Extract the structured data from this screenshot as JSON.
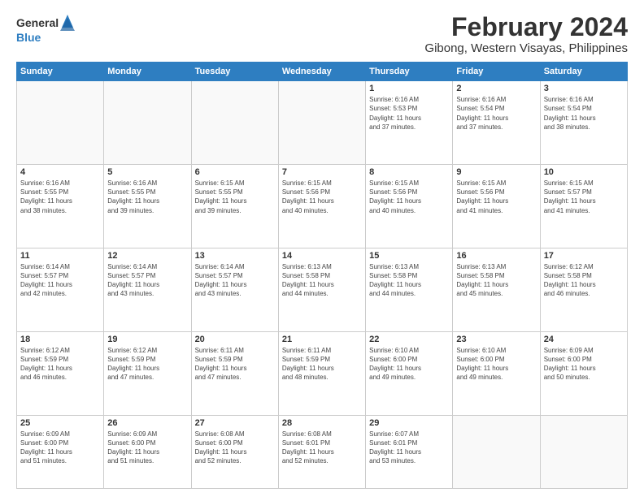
{
  "header": {
    "logo_general": "General",
    "logo_blue": "Blue",
    "month": "February 2024",
    "location": "Gibong, Western Visayas, Philippines"
  },
  "days_of_week": [
    "Sunday",
    "Monday",
    "Tuesday",
    "Wednesday",
    "Thursday",
    "Friday",
    "Saturday"
  ],
  "weeks": [
    [
      {
        "day": "",
        "info": ""
      },
      {
        "day": "",
        "info": ""
      },
      {
        "day": "",
        "info": ""
      },
      {
        "day": "",
        "info": ""
      },
      {
        "day": "1",
        "info": "Sunrise: 6:16 AM\nSunset: 5:53 PM\nDaylight: 11 hours\nand 37 minutes."
      },
      {
        "day": "2",
        "info": "Sunrise: 6:16 AM\nSunset: 5:54 PM\nDaylight: 11 hours\nand 37 minutes."
      },
      {
        "day": "3",
        "info": "Sunrise: 6:16 AM\nSunset: 5:54 PM\nDaylight: 11 hours\nand 38 minutes."
      }
    ],
    [
      {
        "day": "4",
        "info": "Sunrise: 6:16 AM\nSunset: 5:55 PM\nDaylight: 11 hours\nand 38 minutes."
      },
      {
        "day": "5",
        "info": "Sunrise: 6:16 AM\nSunset: 5:55 PM\nDaylight: 11 hours\nand 39 minutes."
      },
      {
        "day": "6",
        "info": "Sunrise: 6:15 AM\nSunset: 5:55 PM\nDaylight: 11 hours\nand 39 minutes."
      },
      {
        "day": "7",
        "info": "Sunrise: 6:15 AM\nSunset: 5:56 PM\nDaylight: 11 hours\nand 40 minutes."
      },
      {
        "day": "8",
        "info": "Sunrise: 6:15 AM\nSunset: 5:56 PM\nDaylight: 11 hours\nand 40 minutes."
      },
      {
        "day": "9",
        "info": "Sunrise: 6:15 AM\nSunset: 5:56 PM\nDaylight: 11 hours\nand 41 minutes."
      },
      {
        "day": "10",
        "info": "Sunrise: 6:15 AM\nSunset: 5:57 PM\nDaylight: 11 hours\nand 41 minutes."
      }
    ],
    [
      {
        "day": "11",
        "info": "Sunrise: 6:14 AM\nSunset: 5:57 PM\nDaylight: 11 hours\nand 42 minutes."
      },
      {
        "day": "12",
        "info": "Sunrise: 6:14 AM\nSunset: 5:57 PM\nDaylight: 11 hours\nand 43 minutes."
      },
      {
        "day": "13",
        "info": "Sunrise: 6:14 AM\nSunset: 5:57 PM\nDaylight: 11 hours\nand 43 minutes."
      },
      {
        "day": "14",
        "info": "Sunrise: 6:13 AM\nSunset: 5:58 PM\nDaylight: 11 hours\nand 44 minutes."
      },
      {
        "day": "15",
        "info": "Sunrise: 6:13 AM\nSunset: 5:58 PM\nDaylight: 11 hours\nand 44 minutes."
      },
      {
        "day": "16",
        "info": "Sunrise: 6:13 AM\nSunset: 5:58 PM\nDaylight: 11 hours\nand 45 minutes."
      },
      {
        "day": "17",
        "info": "Sunrise: 6:12 AM\nSunset: 5:58 PM\nDaylight: 11 hours\nand 46 minutes."
      }
    ],
    [
      {
        "day": "18",
        "info": "Sunrise: 6:12 AM\nSunset: 5:59 PM\nDaylight: 11 hours\nand 46 minutes."
      },
      {
        "day": "19",
        "info": "Sunrise: 6:12 AM\nSunset: 5:59 PM\nDaylight: 11 hours\nand 47 minutes."
      },
      {
        "day": "20",
        "info": "Sunrise: 6:11 AM\nSunset: 5:59 PM\nDaylight: 11 hours\nand 47 minutes."
      },
      {
        "day": "21",
        "info": "Sunrise: 6:11 AM\nSunset: 5:59 PM\nDaylight: 11 hours\nand 48 minutes."
      },
      {
        "day": "22",
        "info": "Sunrise: 6:10 AM\nSunset: 6:00 PM\nDaylight: 11 hours\nand 49 minutes."
      },
      {
        "day": "23",
        "info": "Sunrise: 6:10 AM\nSunset: 6:00 PM\nDaylight: 11 hours\nand 49 minutes."
      },
      {
        "day": "24",
        "info": "Sunrise: 6:09 AM\nSunset: 6:00 PM\nDaylight: 11 hours\nand 50 minutes."
      }
    ],
    [
      {
        "day": "25",
        "info": "Sunrise: 6:09 AM\nSunset: 6:00 PM\nDaylight: 11 hours\nand 51 minutes."
      },
      {
        "day": "26",
        "info": "Sunrise: 6:09 AM\nSunset: 6:00 PM\nDaylight: 11 hours\nand 51 minutes."
      },
      {
        "day": "27",
        "info": "Sunrise: 6:08 AM\nSunset: 6:00 PM\nDaylight: 11 hours\nand 52 minutes."
      },
      {
        "day": "28",
        "info": "Sunrise: 6:08 AM\nSunset: 6:01 PM\nDaylight: 11 hours\nand 52 minutes."
      },
      {
        "day": "29",
        "info": "Sunrise: 6:07 AM\nSunset: 6:01 PM\nDaylight: 11 hours\nand 53 minutes."
      },
      {
        "day": "",
        "info": ""
      },
      {
        "day": "",
        "info": ""
      }
    ]
  ]
}
